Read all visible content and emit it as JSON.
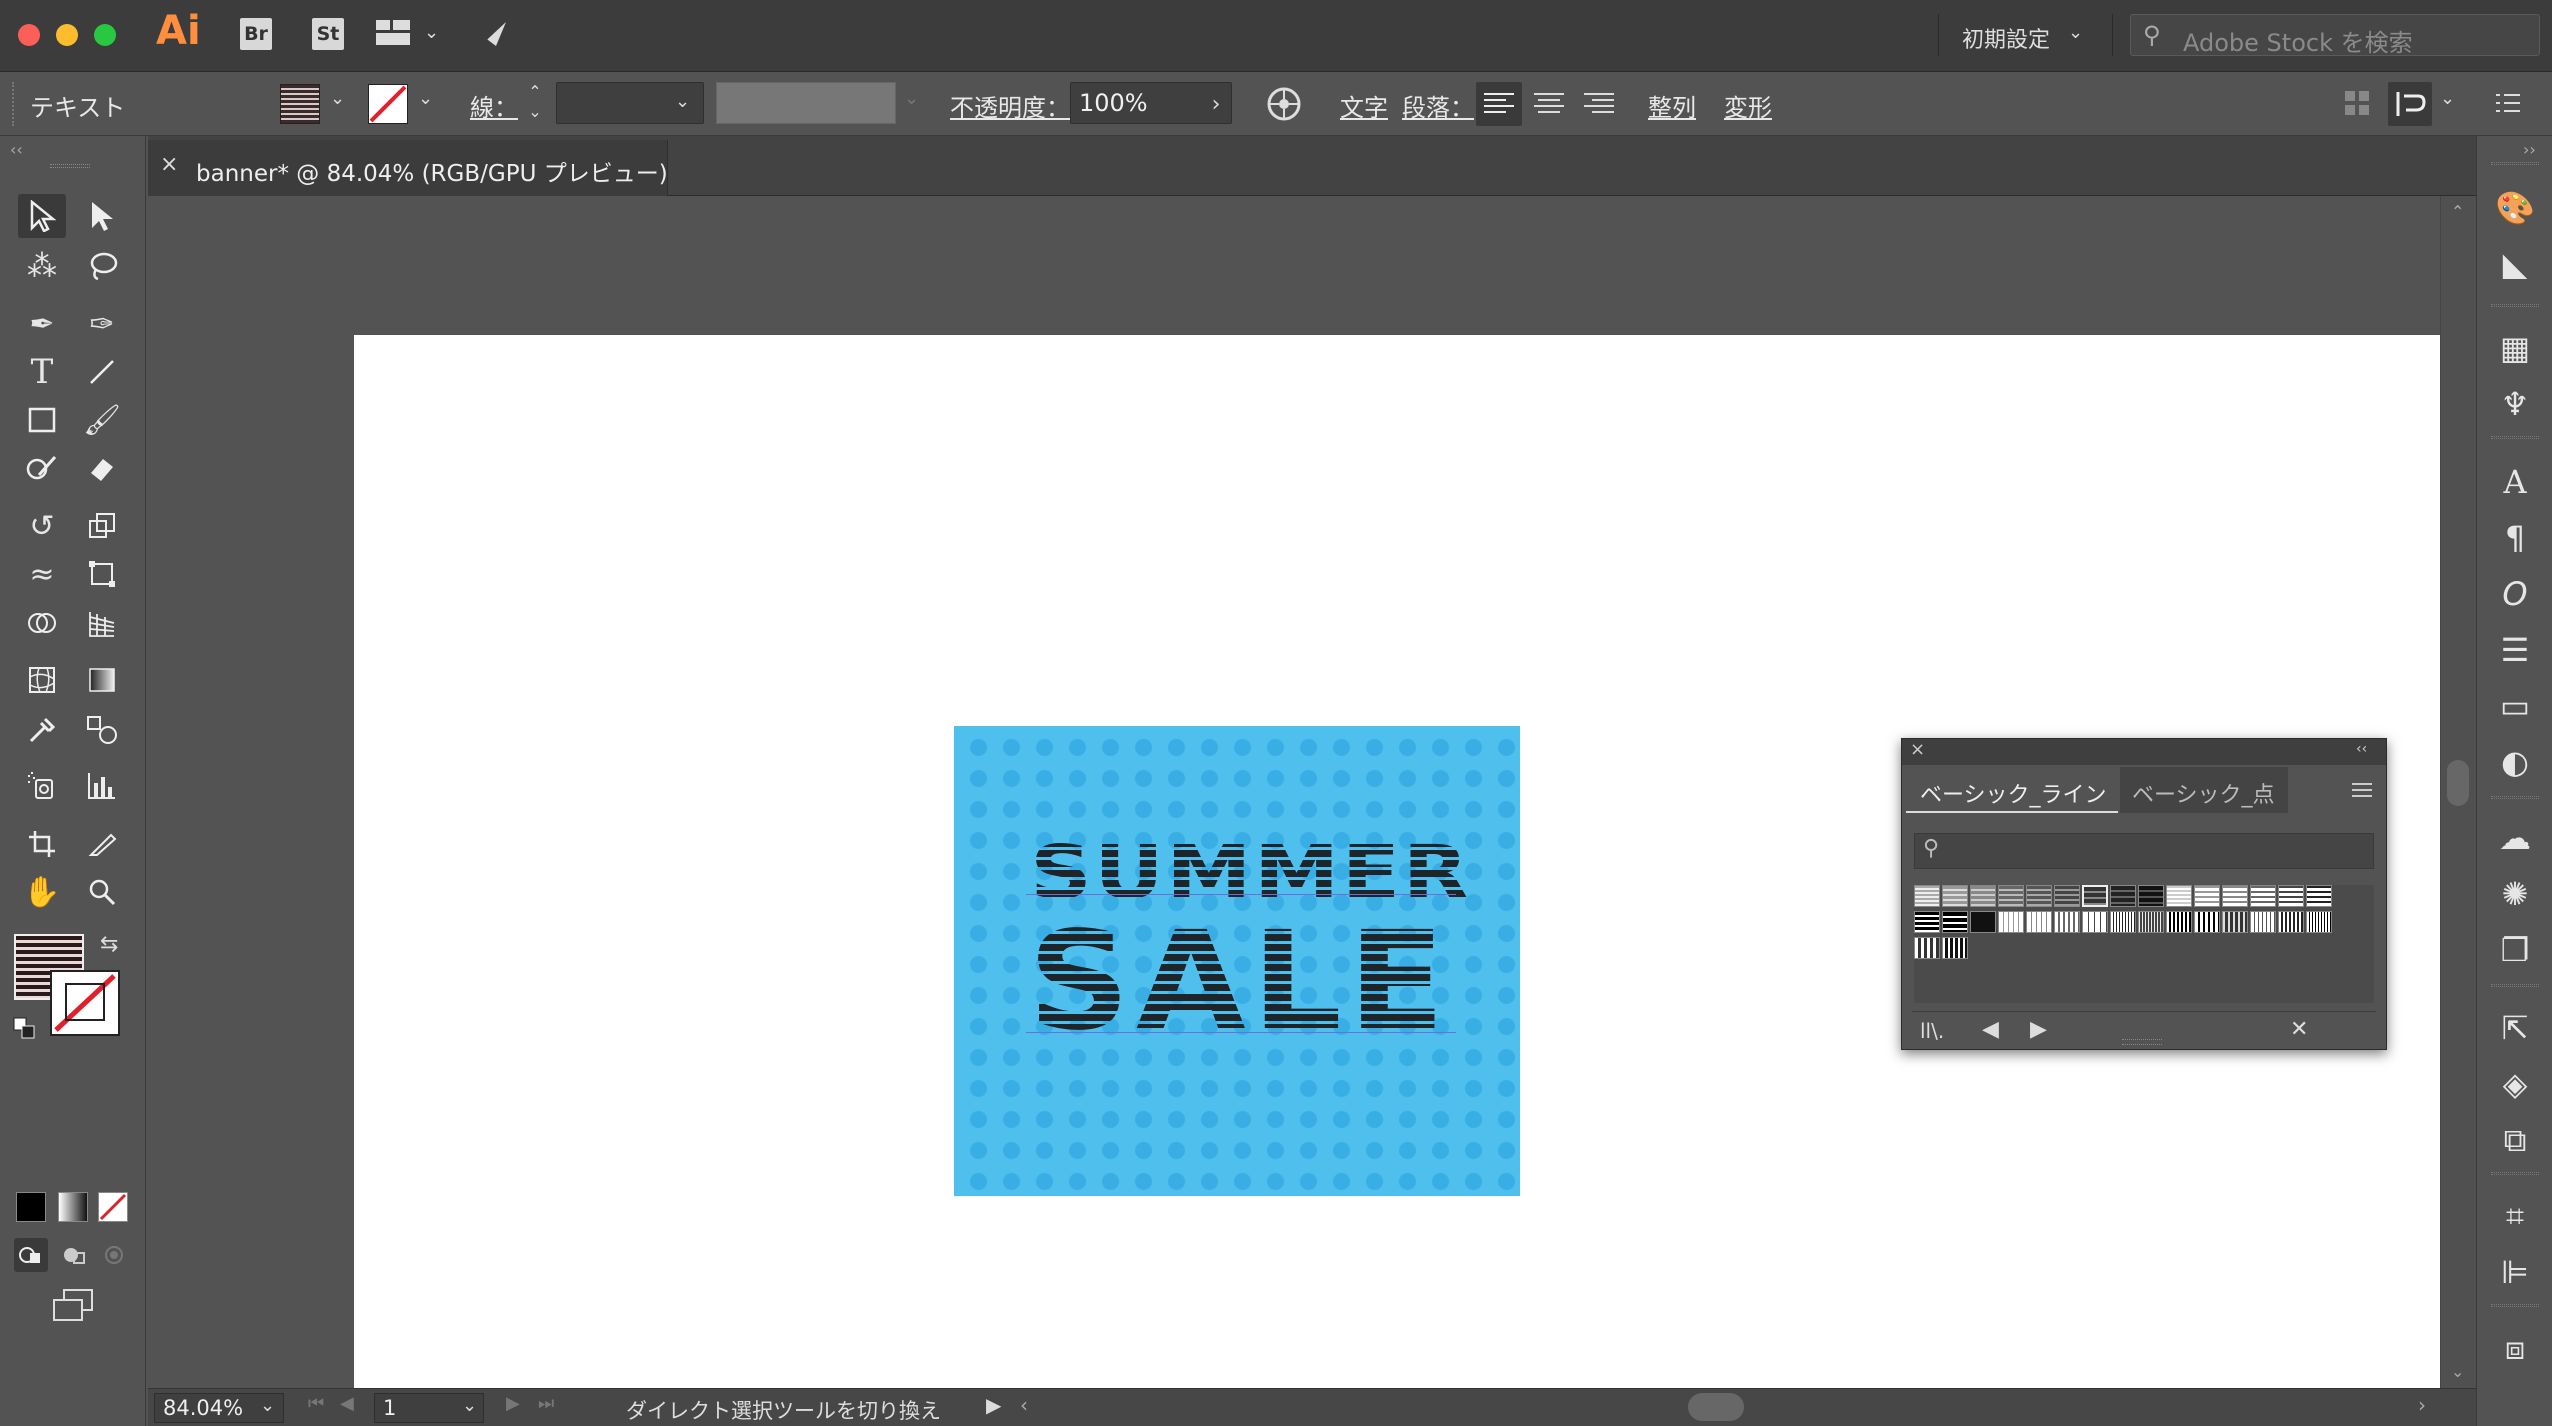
{
  "titlebar": {
    "app_name": "Ai",
    "bridge_label": "Br",
    "stock_label": "St",
    "workspace": "初期設定",
    "search_placeholder": "Adobe Stock を検索"
  },
  "controlbar": {
    "selection_type": "テキスト",
    "stroke_label": "線：",
    "opacity_label": "不透明度：",
    "opacity_value": "100%",
    "character_link": "文字",
    "paragraph_link": "段落：",
    "align_link": "整列",
    "transform_link": "変形"
  },
  "document": {
    "tab_title": "banner* @ 84.04% (RGB/GPU プレビュー)"
  },
  "artwork": {
    "line1": "SUMMER",
    "line2": "SALE",
    "background_color": "#4fbfee",
    "dot_color": "#39aee4",
    "text_color": "#1f2429"
  },
  "swatch_panel": {
    "tab_active": "ベーシック_ライン",
    "tab_inactive": "ベーシック_点"
  },
  "statusbar": {
    "zoom": "84.04%",
    "artboard_number": "1",
    "status_text": "ダイレクト選択ツールを切り換え"
  },
  "icons": [
    "close-icon",
    "minimize-icon",
    "zoom-icon",
    "selection-tool-icon",
    "direct-selection-tool-icon",
    "magic-wand-icon",
    "lasso-icon",
    "pen-icon",
    "curvature-icon",
    "type-icon",
    "line-icon",
    "rectangle-icon",
    "paintbrush-icon",
    "shaper-icon",
    "eraser-icon",
    "rotate-icon",
    "scale-icon",
    "width-icon",
    "free-transform-icon",
    "shape-builder-icon",
    "perspective-icon",
    "mesh-icon",
    "gradient-icon",
    "eyedropper-icon",
    "blend-icon",
    "symbol-sprayer-icon",
    "graph-icon",
    "artboard-icon",
    "slice-icon",
    "hand-icon",
    "zoom-tool-icon"
  ]
}
